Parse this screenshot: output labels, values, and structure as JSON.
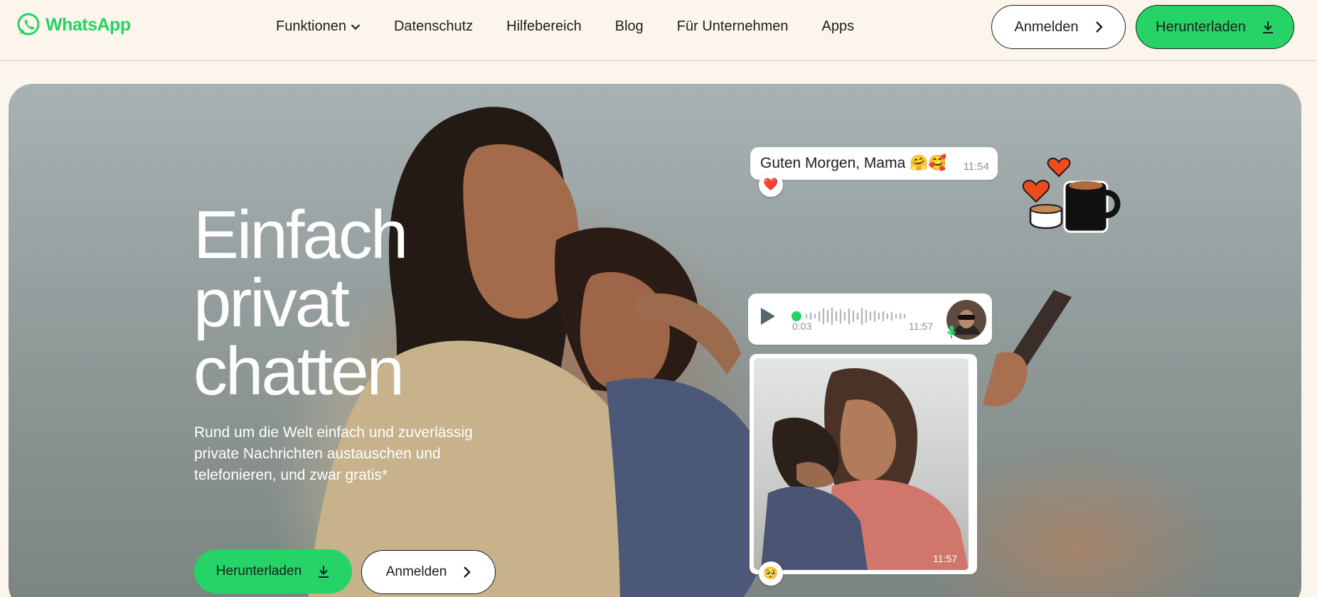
{
  "brand": {
    "name": "WhatsApp",
    "color": "#25d366"
  },
  "nav": {
    "items": [
      {
        "label": "Funktionen",
        "has_dropdown": true
      },
      {
        "label": "Datenschutz"
      },
      {
        "label": "Hilfebereich"
      },
      {
        "label": "Blog"
      },
      {
        "label": "Für Unternehmen"
      },
      {
        "label": "Apps"
      }
    ],
    "login_label": "Anmelden",
    "download_label": "Herunterladen"
  },
  "hero": {
    "headline": [
      "Einfach",
      "privat",
      "chatten"
    ],
    "subtext": "Rund um die Welt einfach und zuverlässig private Nachrichten austauschen und telefonieren, und zwar gratis*",
    "download_label": "Herunterladen",
    "login_label": "Anmelden"
  },
  "chat": {
    "message": {
      "text": "Guten Morgen, Mama 🤗🥰",
      "time": "11:54",
      "reaction": "❤️"
    },
    "voice": {
      "current": "0:03",
      "time": "11:57"
    },
    "photo": {
      "time": "11:57",
      "reaction": "🥺"
    }
  },
  "icons": {
    "dropdown": "chevron-down-icon",
    "arrow": "chevron-right-icon",
    "download": "download-icon",
    "play": "play-icon",
    "mic": "microphone-icon"
  }
}
